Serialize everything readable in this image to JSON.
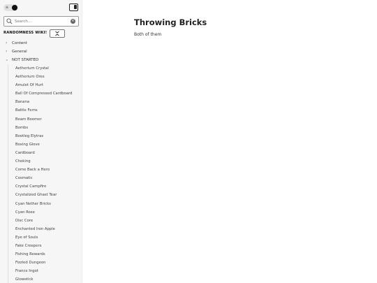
{
  "sidebar": {
    "search": {
      "placeholder": "Search...",
      "value": ""
    },
    "wiki_title": "RANDOMNESS WIKI!",
    "collapse_glyph": "✕",
    "folders": [
      {
        "label": "Content",
        "expanded": false
      },
      {
        "label": "General",
        "expanded": false
      },
      {
        "label": "NOT STARTED",
        "expanded": true
      }
    ],
    "not_started_items": [
      "Aetherium Crystal",
      "Aetherium Ores",
      "Amulet Of Hurt",
      "Ball Of Compressed Cardboard",
      "Banana",
      "Battle Ferns",
      "Beam Boomer",
      "Bombs",
      "Bootleg Elytras",
      "Boxing Glove",
      "Cardboard",
      "Choking",
      "Come Back a Hero",
      "Cosmatic",
      "Crystal Campfire",
      "Crystalized Ghast Tear",
      "Cyan Nether Bricks",
      "Cyan Rose",
      "Disc Core",
      "Enchanted Iron Apple",
      "Eye of Souls",
      "Fake Creepers",
      "Fishing Rewards",
      "Fizzled Dungeon",
      "France Ingot",
      "Glowstick"
    ]
  },
  "main": {
    "title": "Throwing Bricks",
    "body": "Both of them"
  },
  "colors": {
    "sidebar_bg": "#f6f6f6",
    "text": "#222222",
    "accent": "#111111"
  }
}
